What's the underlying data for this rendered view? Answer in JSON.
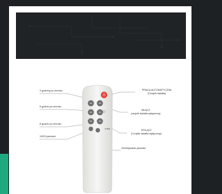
{
  "colors": {
    "background": "#1e2124",
    "accent": "#1fa97e",
    "card": "#ffffff",
    "remote_body": "#f1f1ef",
    "remote_button": "#6d6f72",
    "power_button": "#e03a2f",
    "callout_line": "#7a7a7a"
  },
  "callouts": {
    "left": [
      "3 godziny po zmroku",
      "5 godzin po zmroku",
      "8 godzin po zmroku",
      "100% jasności"
    ],
    "right": {
      "auto_mode": [
        "PRACA AUTOMATYCZNA",
        "(Czujnik światła)"
      ],
      "on": [
        "WŁĄCZ",
        "(czujnik światła wyłączony)"
      ],
      "off": [
        "WYŁĄCZ",
        "(Czujnik światła wyłączony)"
      ],
      "dim": "Zmniejszanie jasności"
    }
  },
  "remote": {
    "brand": "V-TAC",
    "icons": [
      "power-icon",
      "bulb-icon"
    ]
  }
}
